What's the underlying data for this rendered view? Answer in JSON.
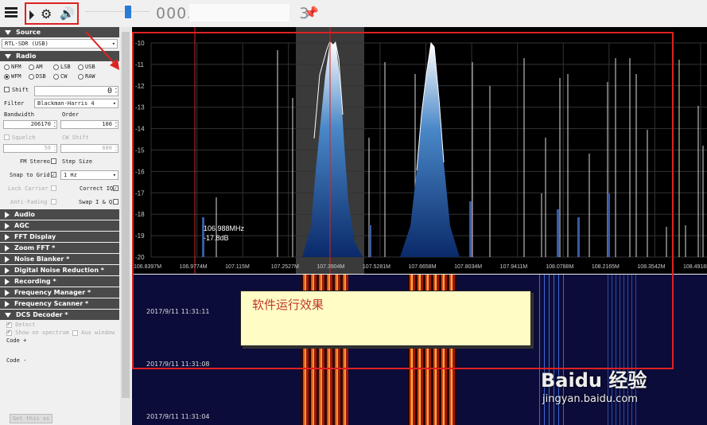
{
  "toolbar": {
    "frequency": "000.",
    "frequency_suffix": "3"
  },
  "sections": {
    "source": "Source",
    "radio": "Radio",
    "audio": "Audio",
    "agc": "AGC",
    "fft": "FFT Display",
    "zoom": "Zoom FFT *",
    "noise_blanker": "Noise Blanker *",
    "dnr": "Digital Noise Reduction *",
    "recording": "Recording *",
    "freq_manager": "Frequency Manager *",
    "freq_scanner": "Frequency Scanner *",
    "dcs": "DCS Decoder *"
  },
  "source_device": "RTL-SDR (USB)",
  "modes_row1": [
    "NFM",
    "AM",
    "LSB",
    "USB"
  ],
  "modes_row2": [
    "WFM",
    "DSB",
    "CW",
    "RAW"
  ],
  "selected_mode": "WFM",
  "radio": {
    "shift_label": "Shift",
    "shift_value": "0",
    "filter_label": "Filter",
    "filter_value": "Blackman-Harris 4",
    "bandwidth_label": "Bandwidth",
    "bandwidth_value": "206170",
    "order_label": "Order",
    "order_value": "100",
    "squelch_label": "Squelch",
    "squelch_value": "50",
    "cwshift_label": "CW Shift",
    "cwshift_value": "600",
    "fm_stereo": "FM Stereo",
    "step_size": "Step Size",
    "snap_to_grid": "Snap to Grid",
    "snap_value": "1 Hz",
    "lock_carrier": "Lock Carrier",
    "correct_iq": "Correct IQ",
    "anti_fading": "Anti-Fading",
    "swap_iq": "Swap I & Q"
  },
  "dcs": {
    "detect": "Detect",
    "show_on_spectrum": "Show on spectrum",
    "aux_window": "Aux window",
    "code1": "Code +",
    "code2": "Code -",
    "button": "Get this ss"
  },
  "spectrum": {
    "y_ticks": [
      "-10",
      "-11",
      "-12",
      "-13",
      "-14",
      "-15",
      "-16",
      "-17",
      "-18",
      "-19",
      "-20"
    ],
    "x_ticks": [
      "106.8397M",
      "106.9774M",
      "107.115M",
      "107.2527M",
      "107.3904M",
      "107.5281M",
      "107.6658M",
      "107.8034M",
      "107.9411M",
      "108.0788M",
      "108.2165M",
      "108.3542M",
      "108.4918M"
    ],
    "cursor_freq": "106.988MHz",
    "cursor_level": "-17.8dB"
  },
  "waterfall": {
    "timestamps": [
      "2017/9/11 11:31:11",
      "2017/9/11 11:31:08",
      "2017/9/11 11:31:04"
    ]
  },
  "note_text": "软件运行效果",
  "watermark": {
    "brand": "Baidu 经验",
    "url": "jingyan.baidu.com"
  },
  "colors": {
    "accent": "#d22222",
    "signal": "#2a6ab5",
    "panel_header": "#4a4a4a",
    "note_bg": "#fffcc6"
  }
}
